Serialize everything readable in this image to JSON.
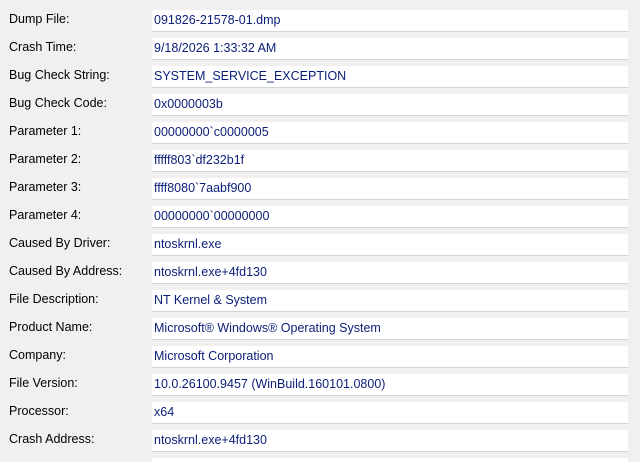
{
  "colors": {
    "background": "#f0f0f0",
    "value_box": "#ffffff",
    "label_text": "#000000",
    "value_text": "#0a1e78"
  },
  "fields": [
    {
      "label": "Dump File:",
      "value": "091826-21578-01.dmp"
    },
    {
      "label": "Crash Time:",
      "value": "9/18/2026 1:33:32 AM"
    },
    {
      "label": "Bug Check String:",
      "value": "SYSTEM_SERVICE_EXCEPTION"
    },
    {
      "label": "Bug Check Code:",
      "value": "0x0000003b"
    },
    {
      "label": "Parameter 1:",
      "value": "00000000`c0000005"
    },
    {
      "label": "Parameter 2:",
      "value": "fffff803`df232b1f"
    },
    {
      "label": "Parameter 3:",
      "value": "ffff8080`7aabf900"
    },
    {
      "label": "Parameter 4:",
      "value": "00000000`00000000"
    },
    {
      "label": "Caused By Driver:",
      "value": "ntoskrnl.exe"
    },
    {
      "label": "Caused By Address:",
      "value": "ntoskrnl.exe+4fd130"
    },
    {
      "label": "File Description:",
      "value": "NT Kernel & System"
    },
    {
      "label": "Product Name:",
      "value": "Microsoft® Windows® Operating System"
    },
    {
      "label": "Company:",
      "value": "Microsoft Corporation"
    },
    {
      "label": "File Version:",
      "value": "10.0.26100.9457 (WinBuild.160101.0800)"
    },
    {
      "label": "Processor:",
      "value": "x64"
    },
    {
      "label": "Crash Address:",
      "value": "ntoskrnl.exe+4fd130"
    }
  ]
}
